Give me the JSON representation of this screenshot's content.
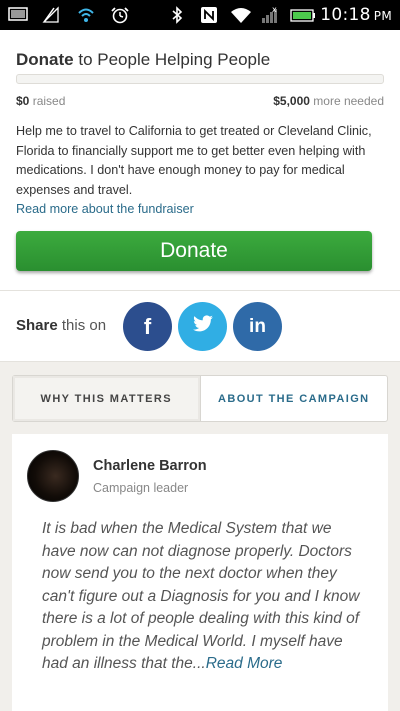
{
  "status_bar": {
    "time": "10:18",
    "ampm": "PM",
    "icons": [
      "image-icon",
      "signal-slash-icon",
      "wifi-calling-icon",
      "alarm-icon",
      "bluetooth-icon",
      "nfc-icon",
      "wifi-icon",
      "cell-signal-icon",
      "battery-icon"
    ]
  },
  "header": {
    "title_bold": "Donate",
    "title_rest": " to People Helping People"
  },
  "progress": {
    "raised_amount": "$0",
    "raised_label": " raised",
    "needed_amount": "$5,000",
    "needed_label": " more needed",
    "fraction": 0
  },
  "description": "Help me to travel to California to get treated or Cleveland Clinic, Florida to financially support me to get better even helping with medications.  I don't have enough money to pay for medical expenses and travel.",
  "read_more_fundraiser": "Read more about the fundraiser",
  "donate_label": "Donate",
  "share": {
    "label_bold": "Share",
    "label_rest": " this on",
    "facebook": "f",
    "linkedin": "in"
  },
  "tabs": [
    {
      "label": "WHY THIS MATTERS",
      "active": true
    },
    {
      "label": "ABOUT THE CAMPAIGN",
      "active": false
    }
  ],
  "leader": {
    "name": "Charlene Barron",
    "role": "Campaign leader",
    "quote": "It is bad when the Medical System that we have now can not diagnose properly. Doctors now send you to the next doctor when they can't figure out a Diagnosis for you and I know there is a lot of people dealing with this kind of problem in the Medical World. I myself have had an illness that the...",
    "quote_more": "Read More"
  },
  "colors": {
    "donate_green": "#2f9a34",
    "link_blue": "#2a6b8a",
    "facebook": "#2c4e8e",
    "twitter": "#30aee4",
    "linkedin": "#2f6aa8"
  }
}
